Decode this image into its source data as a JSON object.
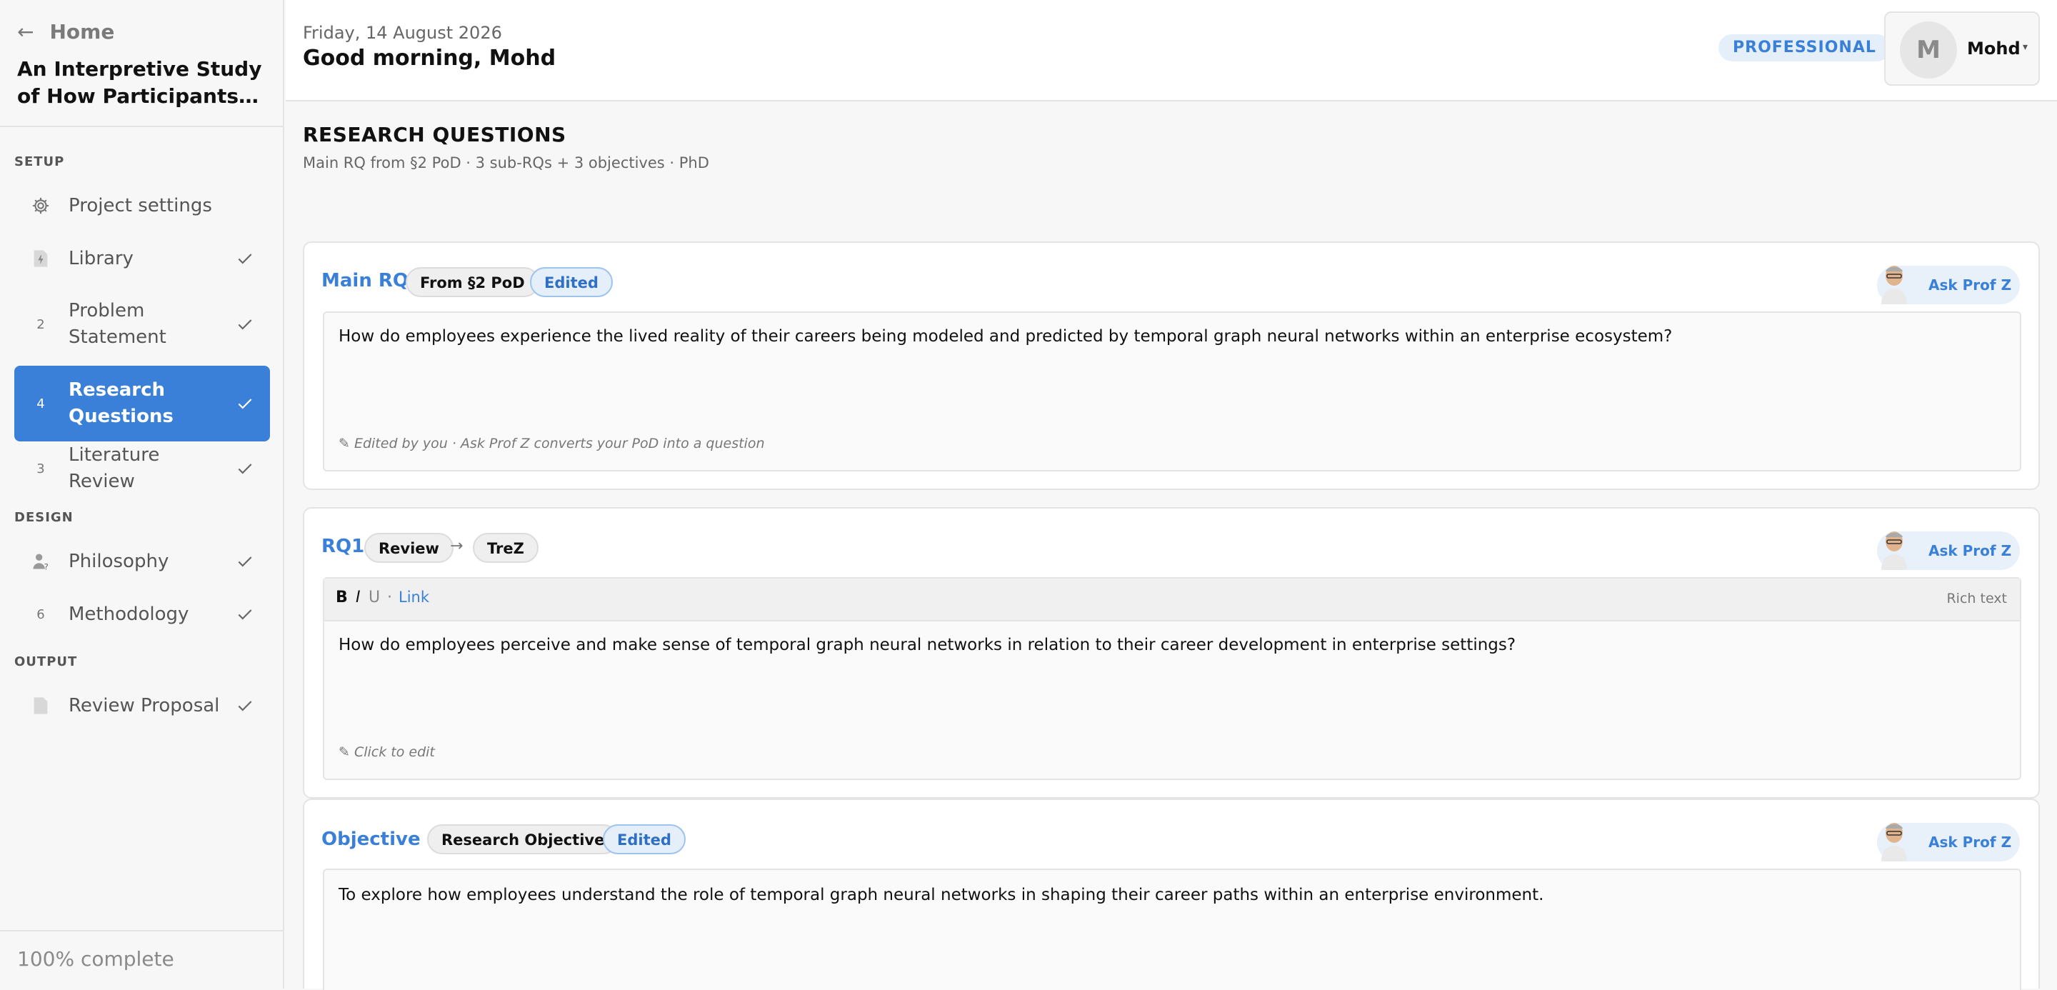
{
  "sidebar": {
    "back_label": "Home",
    "project_title": "An Interpretive Study of How Participants…",
    "sections": {
      "setup": "SETUP",
      "design": "DESIGN",
      "output": "OUTPUT"
    },
    "items": [
      {
        "label": "Project settings",
        "icon": "gear-icon",
        "checked": false
      },
      {
        "label": "Library",
        "icon": "document-bolt-icon",
        "checked": true
      },
      {
        "label": "Problem Statement",
        "icon": "2",
        "checked": true
      },
      {
        "label": "Research Questions",
        "icon": "4",
        "checked": true,
        "active": true
      },
      {
        "label": "Literature Review",
        "icon": "3",
        "checked": true
      },
      {
        "label": "Philosophy",
        "icon": "person-question-icon",
        "checked": true
      },
      {
        "label": "Methodology",
        "icon": "6",
        "checked": true
      },
      {
        "label": "Review Proposal",
        "icon": "document-icon",
        "checked": true
      }
    ],
    "progress_text": "100% complete",
    "progress_value": 1.0
  },
  "header": {
    "date": "Friday, 14 August 2026",
    "greeting": "Good morning, Mohd",
    "plan_badge": "PROFESSIONAL",
    "user": {
      "initial": "M",
      "name": "Mohd"
    }
  },
  "main": {
    "heading": "RESEARCH QUESTIONS",
    "subtitle": "Main RQ from §2 PoD · 3 sub-RQs + 3 objectives · PhD",
    "ask_label": "Ask Prof Z",
    "cards": [
      {
        "title": "Main RQ",
        "chips": [
          "From §2 PoD",
          "Edited"
        ],
        "text": "How do employees experience the lived reality of their careers being modeled and predicted by temporal graph neural networks within an enterprise ecosystem?",
        "note": "✎ Edited by you · Ask Prof Z converts your PoD into a question"
      },
      {
        "title": "RQ1",
        "chips": [
          "Review",
          "TreZ"
        ],
        "chip_arrow": "→",
        "toolbar": {
          "bold": "B",
          "italic": "I",
          "underline": "U",
          "sep": "·",
          "link": "Link",
          "mode": "Rich text"
        },
        "text": "How do employees perceive and make sense of temporal graph neural networks in relation to their career development in enterprise settings?",
        "note": "✎ Click to edit"
      },
      {
        "title": "Objective 1",
        "chips": [
          "Research Objective",
          "Edited"
        ],
        "text": "To explore how employees understand the role of temporal graph neural networks in shaping their career paths within an enterprise environment."
      }
    ]
  },
  "colors": {
    "accent": "#3b80d8",
    "badge_bg": "#e5effa"
  }
}
